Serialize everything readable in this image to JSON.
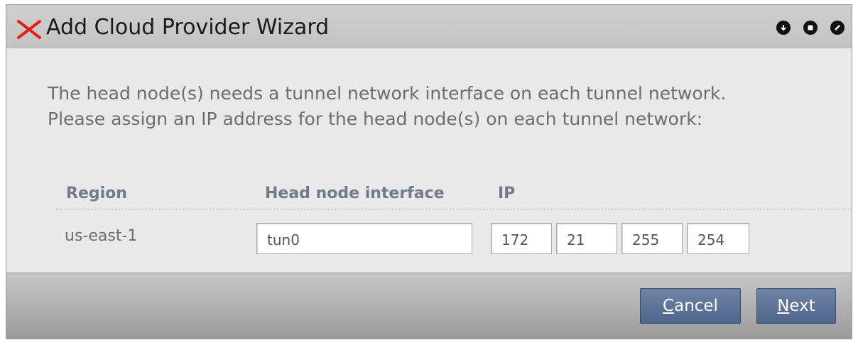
{
  "window": {
    "title": "Add Cloud Provider Wizard",
    "controls": [
      "minimize-icon",
      "maximize-icon",
      "close-icon"
    ]
  },
  "content": {
    "instruction_line1": "The head node(s) needs a tunnel network interface on each tunnel network.",
    "instruction_line2": "Please assign an IP address for the head node(s) on each tunnel network:",
    "table": {
      "headers": [
        "Region",
        "Head node interface",
        "IP"
      ],
      "rows": [
        {
          "region": "us-east-1",
          "interface": "tun0",
          "ip": [
            "172",
            "21",
            "255",
            "254"
          ]
        }
      ]
    }
  },
  "footer": {
    "cancel_label_ul": "C",
    "cancel_label_rest": "ancel",
    "next_label_ul": "N",
    "next_label_rest": "ext"
  },
  "colors": {
    "accent_button": "#5a6f94",
    "close_x": "#e0201a",
    "header_text": "#727b8c"
  }
}
